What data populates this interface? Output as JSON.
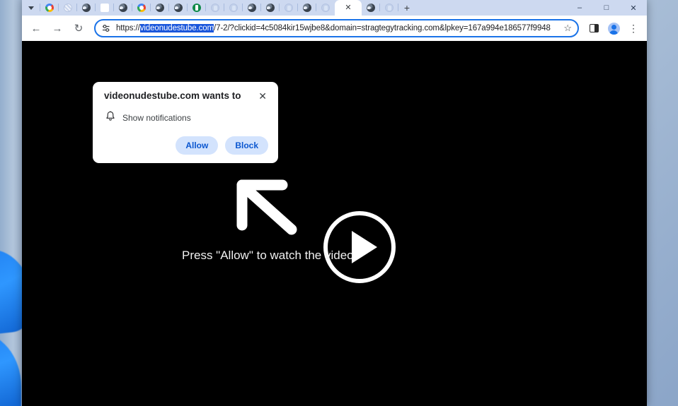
{
  "window": {
    "controls": [
      {
        "name": "minimize",
        "glyph": "–"
      },
      {
        "name": "maximize",
        "glyph": "□"
      },
      {
        "name": "close",
        "glyph": "✕"
      }
    ]
  },
  "tabstrip": {
    "tabs": [
      {
        "icon": "chevron-down-icon",
        "style": "chevron"
      },
      {
        "icon": "google-icon",
        "style": "google"
      },
      {
        "icon": "striped-site-icon",
        "style": "stripe"
      },
      {
        "icon": "dark-site-icon",
        "style": "dark"
      },
      {
        "icon": "blank-page-icon",
        "style": "white"
      },
      {
        "icon": "dark-site-icon",
        "style": "dark"
      },
      {
        "icon": "google-icon",
        "style": "google"
      },
      {
        "icon": "dark-site-icon",
        "style": "dark"
      },
      {
        "icon": "dark-site-icon",
        "style": "dark"
      },
      {
        "icon": "green-site-icon",
        "style": "green"
      },
      {
        "icon": "faint-site-icon",
        "style": "faint"
      },
      {
        "icon": "faint-site-icon",
        "style": "faint"
      },
      {
        "icon": "dark-site-icon",
        "style": "dark"
      },
      {
        "icon": "dark-site-icon",
        "style": "dark"
      },
      {
        "icon": "faint-site-icon",
        "style": "faint"
      },
      {
        "icon": "dark-site-icon",
        "style": "dark"
      },
      {
        "icon": "faint-site-icon",
        "style": "faint"
      }
    ],
    "active_tab": {
      "close_glyph": "✕"
    },
    "trailing_tabs": [
      {
        "icon": "dark-site-icon",
        "style": "dark"
      },
      {
        "icon": "faint-site-icon",
        "style": "faint"
      }
    ],
    "new_tab_glyph": "+"
  },
  "toolbar": {
    "back_glyph": "←",
    "forward_glyph": "→",
    "reload_glyph": "↻",
    "site_info_icon": "tune-icon",
    "url_prefix": "https://",
    "url_selected": "videonudestube.com",
    "url_suffix": "/7-2/?clickid=4c5084kir15wjbe8&domain=stragtegytracking.com&lpkey=167a994e186577f9948",
    "bookmark_glyph": "☆",
    "side_panel_icon": "side-panel-icon",
    "profile_icon": "profile-avatar-icon",
    "menu_glyph": "⋮"
  },
  "permission_bubble": {
    "title": "videonudestube.com wants to",
    "close_glyph": "✕",
    "permission_icon": "bell-icon",
    "permission_label": "Show notifications",
    "allow_label": "Allow",
    "block_label": "Block"
  },
  "page": {
    "center_text": "Press \"Allow\" to watch the video",
    "cursor_icon": "arrow-up-left-icon",
    "play_icon": "play-button-icon",
    "background_color": "#000000"
  },
  "colors": {
    "accent_blue": "#1a73e8",
    "selection_blue": "#1a56db",
    "button_fill": "#d3e3fd",
    "button_text": "#0b57d0",
    "tabstrip": "#cdd9f0"
  }
}
